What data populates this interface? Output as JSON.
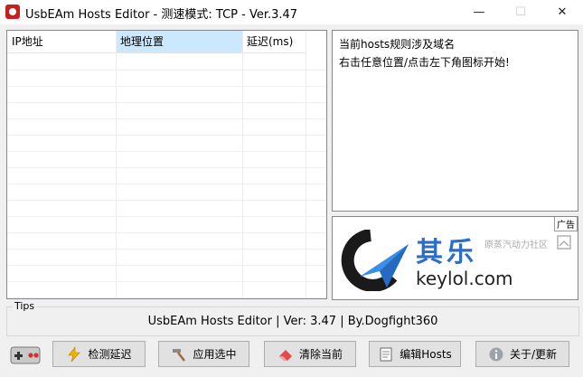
{
  "window": {
    "title": "UsbEAm Hosts Editor - 测速模式: TCP - Ver.3.47",
    "controls": {
      "minimize": "—",
      "maximize": "☐",
      "close": "✕"
    }
  },
  "hosts_list": {
    "columns": [
      "IP地址",
      "地理位置",
      "延迟(ms)"
    ],
    "selected_column": "地理位置",
    "rows": []
  },
  "info": {
    "lines": [
      "当前hosts规则涉及域名",
      "右击任意位置/点击左下角图标开始!"
    ]
  },
  "ad": {
    "tag": "广告",
    "brand_cn": "其乐",
    "brand_en": "keylol.com",
    "subtitle": "原蒸汽动力社区"
  },
  "tips": {
    "label": "Tips",
    "text": "UsbEAm Hosts Editor | Ver: 3.47 | By.Dogfight360"
  },
  "toolbar": {
    "buttons": [
      {
        "id": "test-delay",
        "label": "检测延迟",
        "icon": "lightning-icon"
      },
      {
        "id": "apply-selected",
        "label": "应用选中",
        "icon": "hammer-icon"
      },
      {
        "id": "clear-current",
        "label": "清除当前",
        "icon": "eraser-icon"
      },
      {
        "id": "edit-hosts",
        "label": "编辑Hosts",
        "icon": "notepad-icon"
      },
      {
        "id": "about-update",
        "label": "关于/更新",
        "icon": "info-icon"
      }
    ]
  },
  "colors": {
    "accent_header": "#cce8ff",
    "brand_blue": "#2a6ec8"
  }
}
